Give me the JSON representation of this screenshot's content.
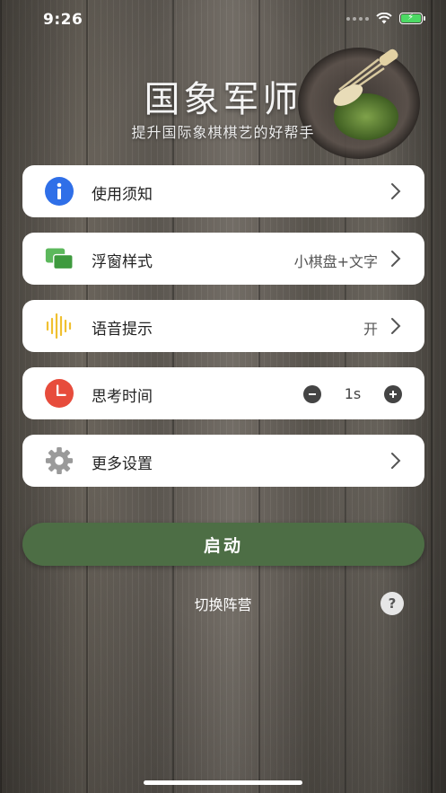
{
  "status_bar": {
    "time": "9:26"
  },
  "header": {
    "title": "国象军师",
    "subtitle": "提升国际象棋棋艺的好帮手"
  },
  "menu": {
    "usage_notice": {
      "label": "使用须知",
      "icon": "info-icon"
    },
    "float_style": {
      "label": "浮窗样式",
      "value": "小棋盘+文字",
      "icon": "windows-icon"
    },
    "voice_prompt": {
      "label": "语音提示",
      "value": "开",
      "icon": "soundwave-icon"
    },
    "think_time": {
      "label": "思考时间",
      "value": "1s",
      "icon": "clock-icon"
    },
    "more_settings": {
      "label": "更多设置",
      "icon": "gear-icon"
    }
  },
  "actions": {
    "start": "启动",
    "switch_camp": "切换阵营",
    "help": "?"
  },
  "colors": {
    "start_button": "#4d6e45",
    "info_blue": "#2f6fe8",
    "window_green": "#4caf50",
    "wave_yellow": "#f0c030",
    "clock_red": "#e74c3c"
  }
}
